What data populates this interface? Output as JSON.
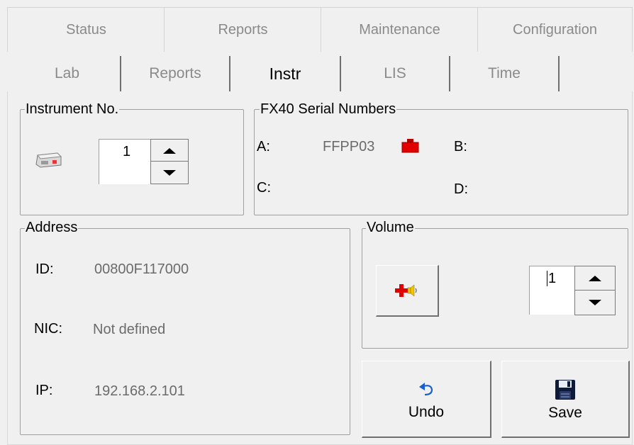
{
  "top_tabs": [
    "Status",
    "Reports",
    "Maintenance",
    "Configuration"
  ],
  "sub_tabs": [
    "Lab",
    "Reports",
    "Instr",
    "LIS",
    "Time"
  ],
  "instrument": {
    "group_label": "Instrument No.",
    "value": "1"
  },
  "serials": {
    "group_label": "FX40 Serial Numbers",
    "a_label": "A:",
    "a_value": "FFPP03",
    "b_label": "B:",
    "c_label": "C:",
    "d_label": "D:"
  },
  "address": {
    "group_label": "Address",
    "id_label": "ID:",
    "id_value": "00800F117000",
    "nic_label": "NIC:",
    "nic_value": "Not defined",
    "ip_label": "IP:",
    "ip_value": "192.168.2.101"
  },
  "volume": {
    "group_label": "Volume",
    "value": "1"
  },
  "buttons": {
    "undo": "Undo",
    "save": "Save"
  },
  "colors": {
    "disabled_text": "#8a8a8a",
    "value_text": "#6b6b6b",
    "status_red": "#e00000"
  },
  "icons": {
    "instrument": "instrument-icon",
    "serial_status": "red-status-icon",
    "volume_test": "volume-test-icon",
    "undo": "undo-arrow-icon",
    "save": "floppy-disk-icon",
    "spin_up": "arrow-up-icon",
    "spin_down": "arrow-down-icon"
  }
}
